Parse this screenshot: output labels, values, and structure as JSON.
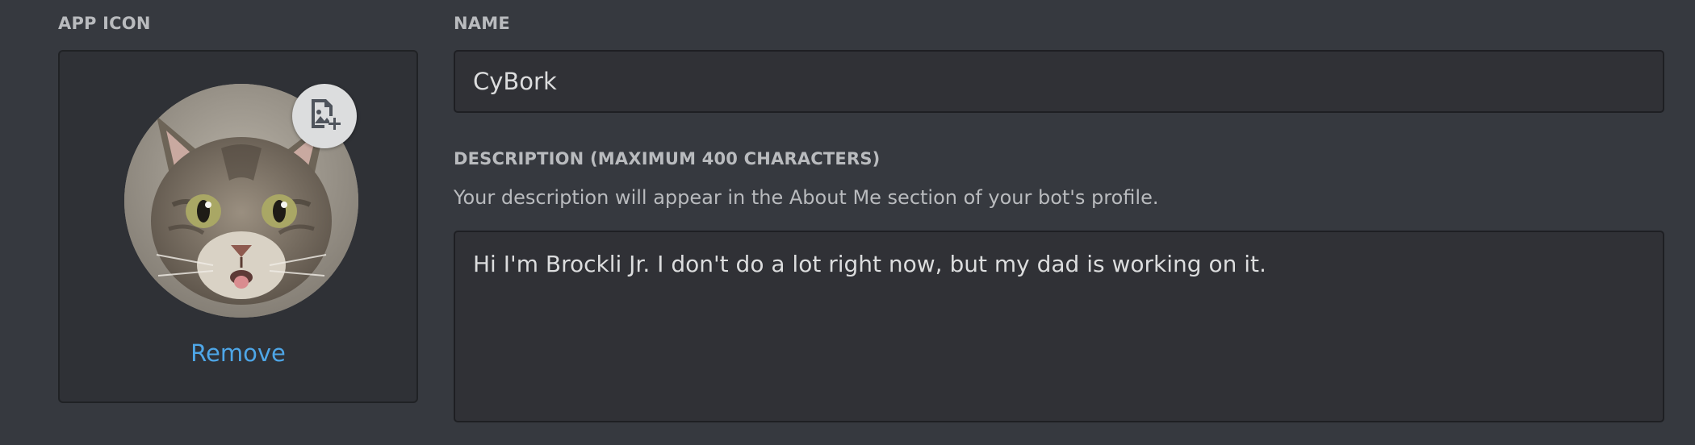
{
  "app_icon": {
    "label": "APP ICON",
    "remove_label": "Remove",
    "upload_icon": "image-add-icon",
    "avatar_subject": "tabby-cat-photo"
  },
  "name": {
    "label": "NAME",
    "value": "CyBork"
  },
  "description": {
    "label": "DESCRIPTION (MAXIMUM 400 CHARACTERS)",
    "helper": "Your description will appear in the About Me section of your bot's profile.",
    "value": "Hi I'm Brockli Jr. I don't do a lot right now, but my dad is working on it."
  },
  "colors": {
    "background": "#36393f",
    "input_background": "#303136",
    "link": "#4ea6e7",
    "label": "#b9bbbe",
    "text": "#dcddde"
  }
}
